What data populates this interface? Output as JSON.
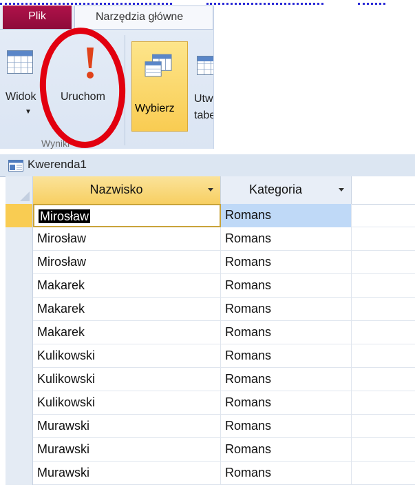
{
  "ribbon": {
    "tabs": {
      "file": "Plik",
      "home": "Narzędzia główne"
    },
    "buttons": {
      "view": "Widok",
      "run": "Uruchom",
      "select": "Wybierz",
      "create_table": "Utwórz tabelę"
    },
    "group_label": "Wyniki"
  },
  "query": {
    "title": "Kwerenda1"
  },
  "table": {
    "columns": [
      "Nazwisko",
      "Kategoria"
    ],
    "rows": [
      [
        "Mirosław",
        "Romans"
      ],
      [
        "Mirosław",
        "Romans"
      ],
      [
        "Mirosław",
        "Romans"
      ],
      [
        "Makarek",
        "Romans"
      ],
      [
        "Makarek",
        "Romans"
      ],
      [
        "Makarek",
        "Romans"
      ],
      [
        "Kulikowski",
        "Romans"
      ],
      [
        "Kulikowski",
        "Romans"
      ],
      [
        "Kulikowski",
        "Romans"
      ],
      [
        "Murawski",
        "Romans"
      ],
      [
        "Murawski",
        "Romans"
      ],
      [
        "Murawski",
        "Romans"
      ]
    ],
    "current_row": 0
  },
  "colors": {
    "accent_file_tab": "#a0103f",
    "highlight_yellow": "#f9cc52",
    "annotation_red": "#e2000f",
    "selection_blue": "#bfd9f7"
  },
  "icons": {
    "view": "datasheet-grid-icon",
    "run": "exclamation-run-icon",
    "select": "select-query-icon",
    "query": "query-icon"
  }
}
